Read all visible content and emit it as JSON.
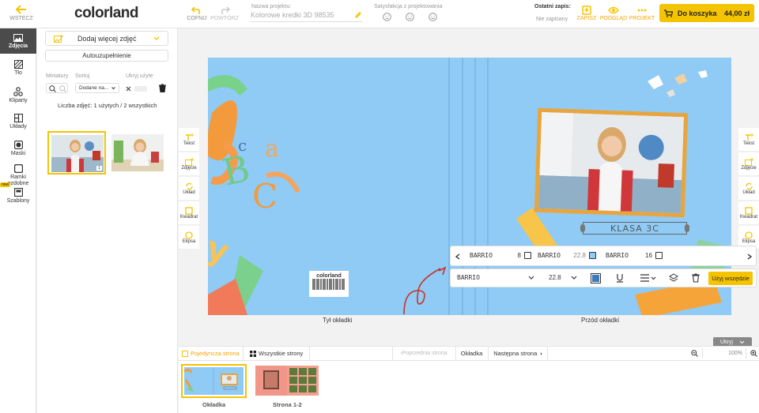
{
  "header": {
    "back_label": "WSTECZ",
    "logo": "colorland",
    "undo_label": "COFNIJ",
    "redo_label": "POWTÓRZ",
    "project_name_label": "Nazwa projektu:",
    "project_name_value": "Kolorowe kredki 3D 98535",
    "satisfaction_label": "Satysfakcja z projektowania",
    "last_save_label": "Ostatni zapis:",
    "last_save_value": "Nie zapisany",
    "save_label": "ZAPISZ",
    "preview_label": "PODGLĄD",
    "project_label": "PROJEKT",
    "cart_label": "Do koszyka",
    "cart_price": "44,00 zł"
  },
  "sidebar": {
    "items": [
      {
        "label": "Zdjęcia",
        "icon": "image-icon"
      },
      {
        "label": "Tło",
        "icon": "background-icon"
      },
      {
        "label": "Kliparty",
        "icon": "clipart-icon"
      },
      {
        "label": "Układy",
        "icon": "layout-icon"
      },
      {
        "label": "Maski",
        "icon": "mask-icon"
      },
      {
        "label": "Ramki ozdobne",
        "icon": "frame-icon"
      },
      {
        "label": "Szablony",
        "icon": "template-icon"
      }
    ],
    "new_badge": "new"
  },
  "panel": {
    "add_photos_label": "Dodaj więcej zdjęć",
    "autofill_label": "Autouzupełnienie",
    "thumbnails_label": "Miniatury",
    "sort_label": "Sortuj",
    "sort_value": "Dodane na...",
    "hide_used_label": "Ukryj użyte",
    "photo_count": "Liczba zdjęć: 1 użytych / 2 wszystkich",
    "used_badge": "1"
  },
  "tools_left": [
    "Tekst",
    "Zdjęcie",
    "Układ",
    "Kwadrat",
    "Elipsa"
  ],
  "tools_right": [
    "Tekst",
    "Zdjęcie",
    "Układ",
    "Kwadrat",
    "Elipsa"
  ],
  "canvas": {
    "back_cover_label": "Tył okładki",
    "front_cover_label": "Przód okładki",
    "barcode_brand": "colorland",
    "class_label": "KLASA 3C"
  },
  "font_toolbar": {
    "presets": [
      {
        "font": "BARRIO",
        "size": "8"
      },
      {
        "font": "BARRIO",
        "size": "22.8"
      },
      {
        "font": "BARRIO",
        "size": "16"
      }
    ],
    "font_value": "BARRIO",
    "size_value": "22.8",
    "apply_all_label": "Użyj wszędzie"
  },
  "bottom": {
    "hide_label": "Ukryj",
    "single_page_label": "Pojedyncza strona",
    "all_pages_label": "Wszystkie strony",
    "prev_page_label": "Poprzednia strona",
    "current_page_label": "Okładka",
    "next_page_label": "Następna strona",
    "zoom_value": "100%",
    "thumbs": [
      {
        "label": "Okładka"
      },
      {
        "label": "Strona 1-2"
      }
    ]
  },
  "colors": {
    "accent": "#f5c400",
    "canvas_bg": "#8fcbf5",
    "dark": "#4b4b4b"
  }
}
